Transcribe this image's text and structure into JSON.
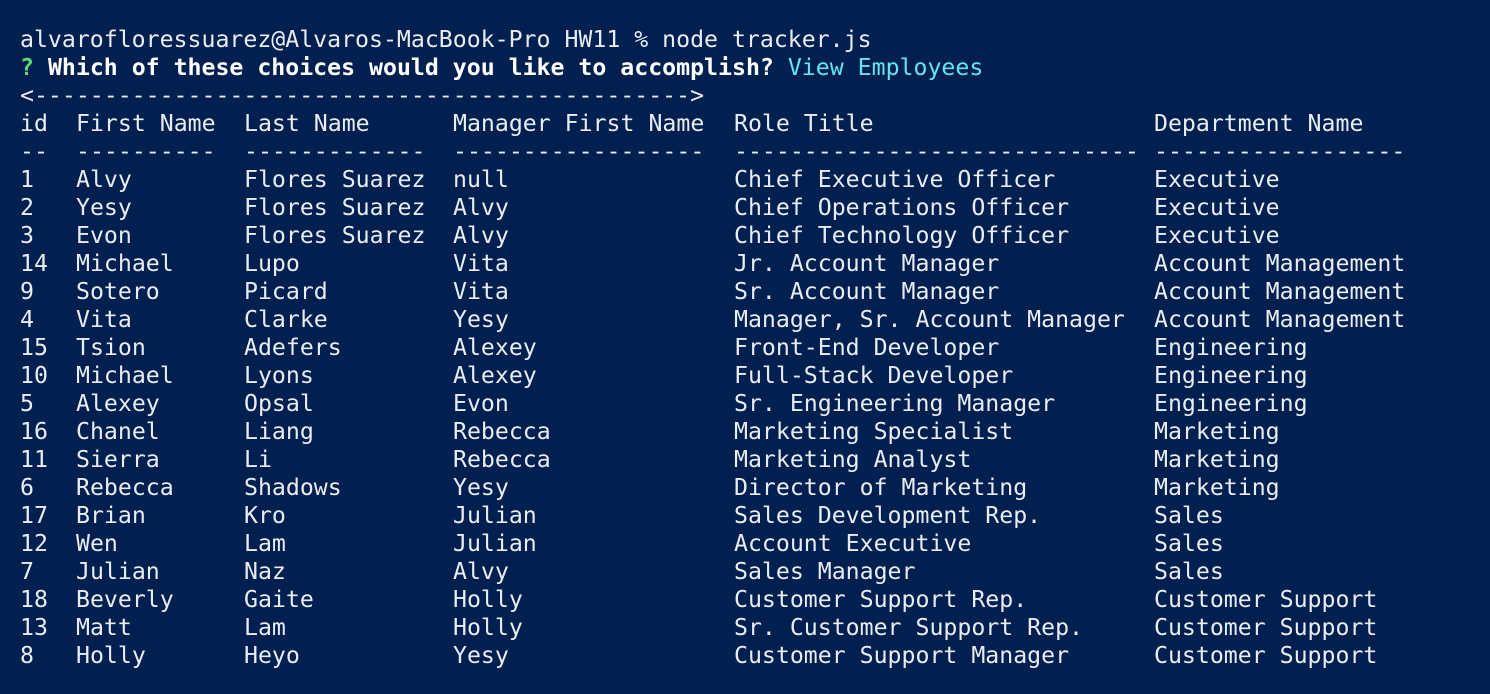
{
  "colors": {
    "background": "#01204f",
    "text": "#e9edf3",
    "prompt_mark": "#5fd87a",
    "answer": "#66e3ec"
  },
  "shell": {
    "prompt": "alvarofloressuarez@Alvaros-MacBook-Pro HW11 % node tracker.js"
  },
  "inquirer": {
    "mark": "?",
    "question": "Which of these choices would you like to accomplish?",
    "answer": "View Employees"
  },
  "table": {
    "banner": "<----------------------------------------------->",
    "columns": [
      "id",
      "First Name",
      "Last Name",
      "Manager First Name",
      "Role Title",
      "Department Name"
    ],
    "separators": [
      "--",
      "----------",
      "-------------",
      "------------------",
      "-----------------------------",
      "------------------"
    ],
    "rows": [
      [
        "1",
        "Alvy",
        "Flores Suarez",
        "null",
        "Chief Executive Officer",
        "Executive"
      ],
      [
        "2",
        "Yesy",
        "Flores Suarez",
        "Alvy",
        "Chief Operations Officer",
        "Executive"
      ],
      [
        "3",
        "Evon",
        "Flores Suarez",
        "Alvy",
        "Chief Technology Officer",
        "Executive"
      ],
      [
        "14",
        "Michael",
        "Lupo",
        "Vita",
        "Jr. Account Manager",
        "Account Management"
      ],
      [
        "9",
        "Sotero",
        "Picard",
        "Vita",
        "Sr. Account Manager",
        "Account Management"
      ],
      [
        "4",
        "Vita",
        "Clarke",
        "Yesy",
        "Manager, Sr. Account Manager",
        "Account Management"
      ],
      [
        "15",
        "Tsion",
        "Adefers",
        "Alexey",
        "Front-End Developer",
        "Engineering"
      ],
      [
        "10",
        "Michael",
        "Lyons",
        "Alexey",
        "Full-Stack Developer",
        "Engineering"
      ],
      [
        "5",
        "Alexey",
        "Opsal",
        "Evon",
        "Sr. Engineering Manager",
        "Engineering"
      ],
      [
        "16",
        "Chanel",
        "Liang",
        "Rebecca",
        "Marketing Specialist",
        "Marketing"
      ],
      [
        "11",
        "Sierra",
        "Li",
        "Rebecca",
        "Marketing Analyst",
        "Marketing"
      ],
      [
        "6",
        "Rebecca",
        "Shadows",
        "Yesy",
        "Director of Marketing",
        "Marketing"
      ],
      [
        "17",
        "Brian",
        "Kro",
        "Julian",
        "Sales Development Rep.",
        "Sales"
      ],
      [
        "12",
        "Wen",
        "Lam",
        "Julian",
        "Account Executive",
        "Sales"
      ],
      [
        "7",
        "Julian",
        "Naz",
        "Alvy",
        "Sales Manager",
        "Sales"
      ],
      [
        "18",
        "Beverly",
        "Gaite",
        "Holly",
        "Customer Support Rep.",
        "Customer Support"
      ],
      [
        "13",
        "Matt",
        "Lam",
        "Holly",
        "Sr. Customer Support Rep.",
        "Customer Support"
      ],
      [
        "8",
        "Holly",
        "Heyo",
        "Yesy",
        "Customer Support Manager",
        "Customer Support"
      ]
    ]
  }
}
